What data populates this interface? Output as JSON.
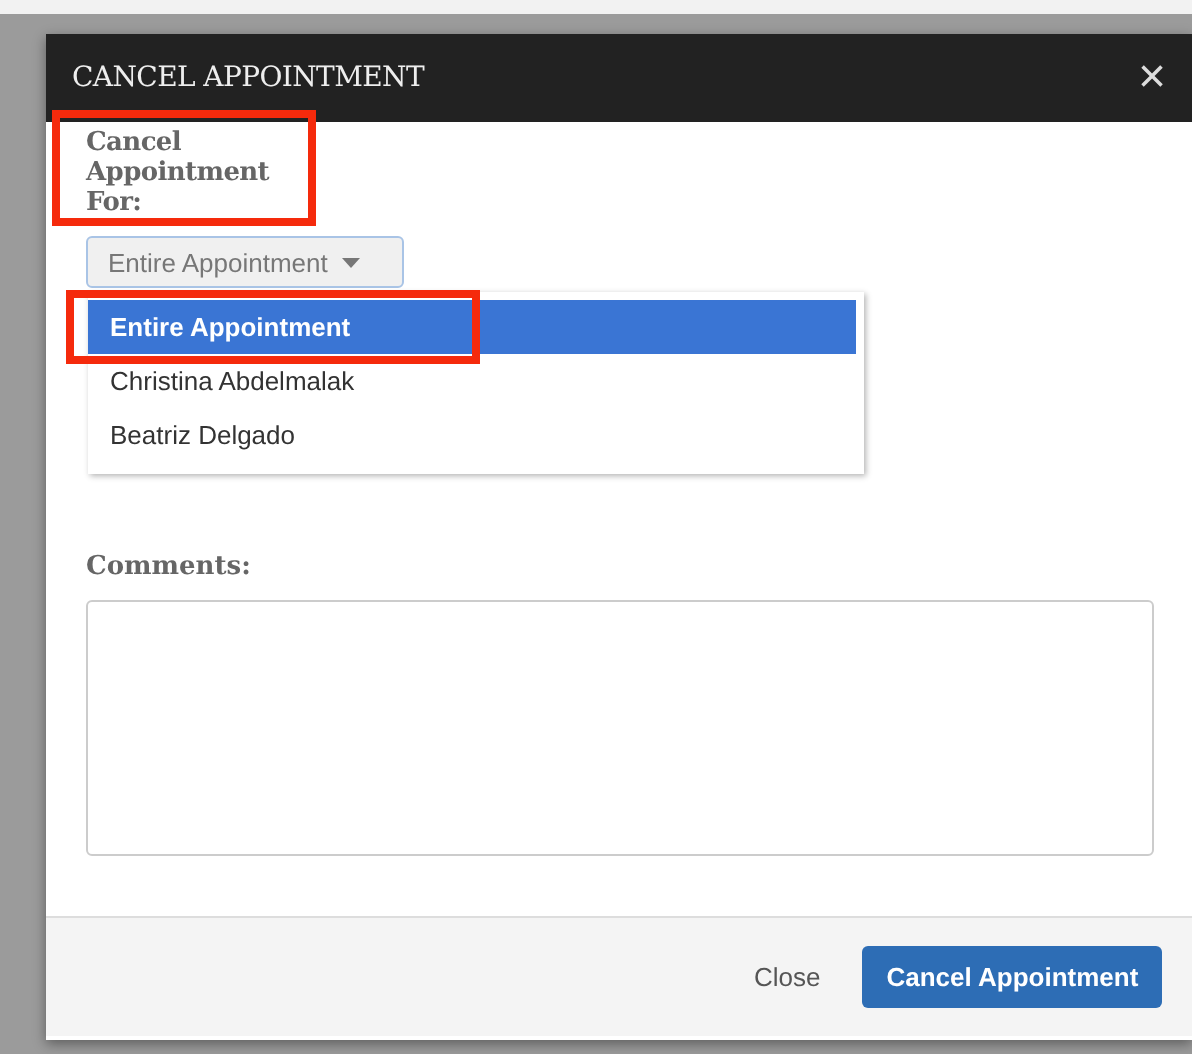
{
  "dialog": {
    "title": "CANCEL APPOINTMENT",
    "close_symbol": "×"
  },
  "cancel_for": {
    "label": "Cancel Appointment For:",
    "highlighted": true,
    "value": "Entire Appointment",
    "expanded": true,
    "options": [
      {
        "label": "Entire Appointment",
        "selected": true,
        "highlighted": true
      },
      {
        "label": "Christina Abdelmalak",
        "selected": false,
        "highlighted": false
      },
      {
        "label": "Beatriz Delgado",
        "selected": false,
        "highlighted": false
      }
    ]
  },
  "comments": {
    "label": "Comments:"
  },
  "buttons": [
    {
      "label": "Close",
      "kind": "link"
    },
    {
      "label": "Cancel Appointment",
      "kind": "primary"
    }
  ]
}
